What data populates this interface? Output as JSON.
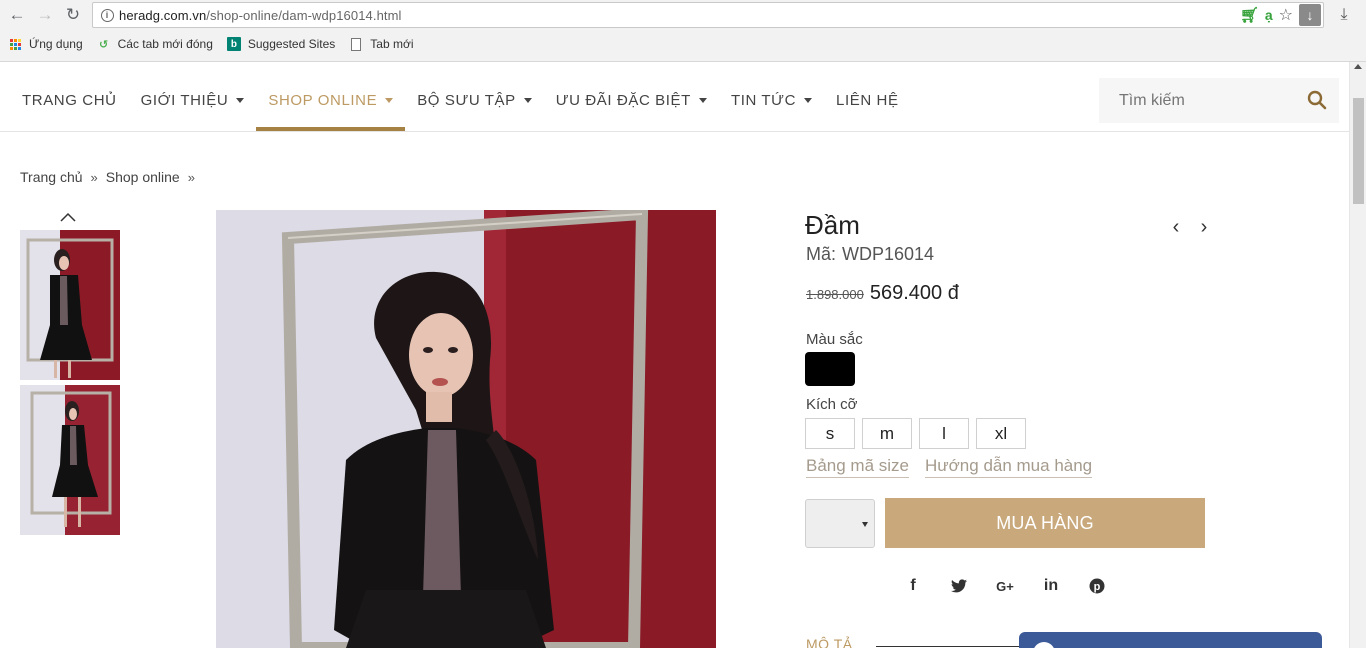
{
  "browser": {
    "url_host": "heradg.com.vn",
    "url_path": "/shop-online/dam-wdp16014.html",
    "bookmarks": [
      {
        "label": "Ứng dụng",
        "icon": "apps-grid-icon"
      },
      {
        "label": "Các tab mới đóng",
        "icon": "history-icon"
      },
      {
        "label": "Suggested Sites",
        "icon": "bing-icon"
      },
      {
        "label": "Tab mới",
        "icon": "page-icon"
      }
    ],
    "extension_a": "ạ"
  },
  "menu": {
    "items": [
      {
        "label": "TRANG CHỦ",
        "dropdown": false
      },
      {
        "label": "GIỚI THIỆU",
        "dropdown": true
      },
      {
        "label": "SHOP ONLINE",
        "dropdown": true,
        "active": true
      },
      {
        "label": "BỘ SƯU TẬP",
        "dropdown": true
      },
      {
        "label": "ƯU ĐÃI ĐẶC BIỆT",
        "dropdown": true
      },
      {
        "label": "TIN TỨC",
        "dropdown": true
      },
      {
        "label": "LIÊN HỆ",
        "dropdown": false
      }
    ],
    "search_placeholder": "Tìm kiếm"
  },
  "breadcrumb": {
    "items": [
      "Trang chủ",
      "Shop online"
    ],
    "separator": "»"
  },
  "product": {
    "title": "Đầm",
    "code_label": "Mã:",
    "code": "WDP16014",
    "old_price": "1.898.000",
    "price": "569.400 đ",
    "color_label": "Màu sắc",
    "colors": [
      "#000000"
    ],
    "size_label": "Kích cỡ",
    "sizes": [
      "s",
      "m",
      "l",
      "xl"
    ],
    "size_chart_link": "Bảng mã size",
    "guide_link": "Hướng dẫn mua hàng",
    "buy_label": "MUA HÀNG",
    "description_tab": "MÔ TẢ"
  },
  "social": [
    "f",
    "t",
    "G+",
    "in",
    "p"
  ],
  "colors": {
    "accent": "#bd9a63",
    "buy_button": "#c9a97c",
    "chat": "#3d5a98"
  }
}
